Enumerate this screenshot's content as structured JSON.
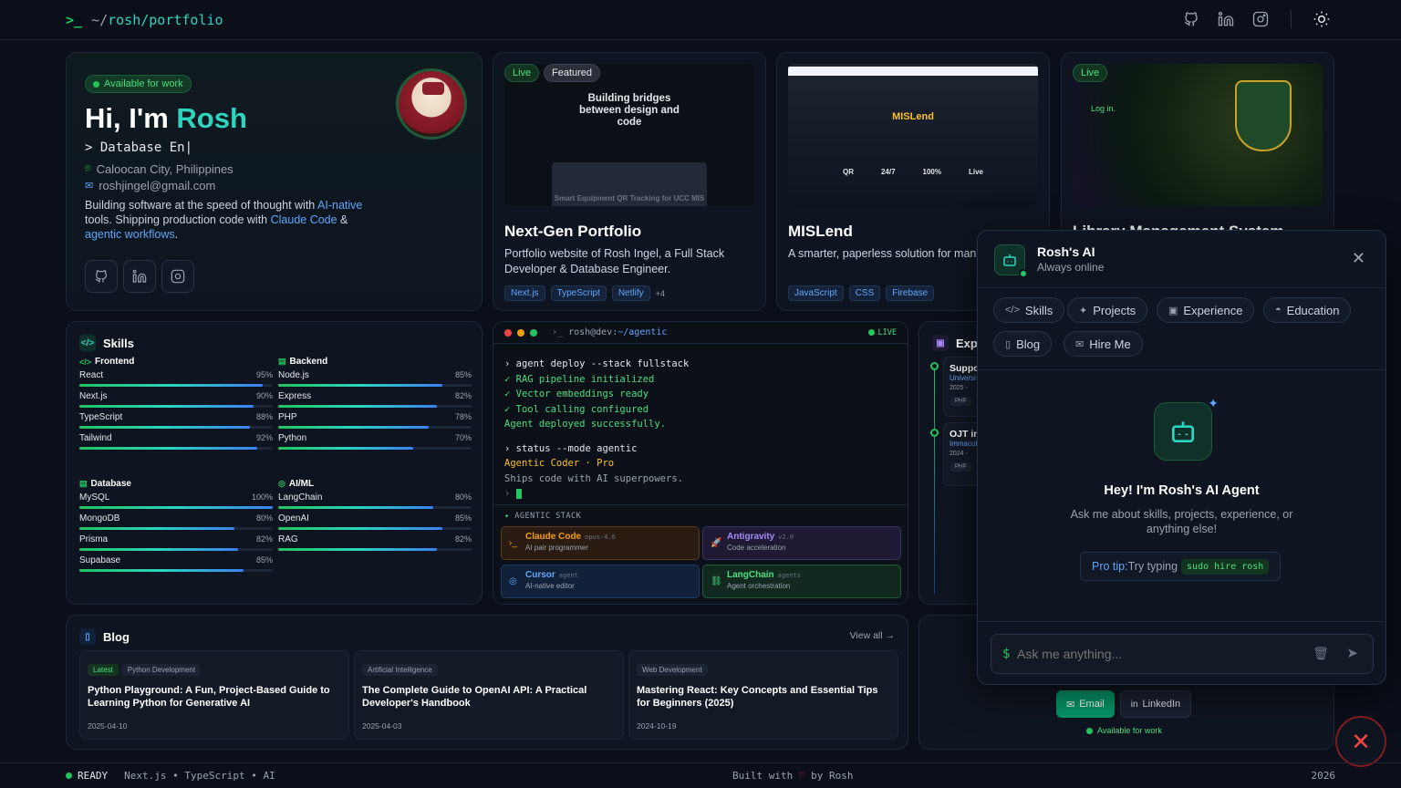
{
  "topbar": {
    "prompt": ">_",
    "path_prefix": "~/",
    "path": "rosh/portfolio"
  },
  "hero": {
    "availability": "Available for work",
    "greeting": "Hi, I'm ",
    "name": "Rosh",
    "typing": "> Database En|",
    "location": "Caloocan City, Philippines",
    "email": "roshjingel@gmail.com",
    "bio_1": "Building software at the speed of thought with ",
    "bio_link_1": "AI-native",
    "bio_2": " tools. Shipping production code with ",
    "bio_link_2": "Claude Code",
    "bio_3": " & ",
    "bio_link_3": "agentic workflows",
    "bio_4": "."
  },
  "projects": [
    {
      "live": "Live",
      "featured": "Featured",
      "screenshot_heading": "Building bridges between design and code",
      "screenshot_sub": "Smart Equipment QR Tracking for UCC MIS",
      "title": "Next-Gen Portfolio",
      "desc": "Portfolio website of Rosh Ingel, a Full Stack Developer & Database Engineer.",
      "tags": [
        "Next.js",
        "TypeScript",
        "Netlify"
      ],
      "more": "+4"
    },
    {
      "screenshot_heading": "MISLend",
      "stats": [
        "QR",
        "24/7",
        "100%",
        "Live"
      ],
      "title": "MISLend",
      "desc": "A smarter, paperless solution for managing classroom tools. Borrow projectors, cabl",
      "tags": [
        "JavaScript",
        "CSS",
        "Firebase"
      ]
    },
    {
      "live": "Live",
      "screenshot_heading": "Log in.",
      "title": "Library Management System"
    }
  ],
  "skills": {
    "title": "Skills",
    "groups": [
      {
        "name": "Frontend",
        "items": [
          {
            "name": "React",
            "pct": "95%",
            "v": 95
          },
          {
            "name": "Next.js",
            "pct": "90%",
            "v": 90
          },
          {
            "name": "TypeScript",
            "pct": "88%",
            "v": 88
          },
          {
            "name": "Tailwind",
            "pct": "92%",
            "v": 92
          }
        ]
      },
      {
        "name": "Backend",
        "items": [
          {
            "name": "Node.js",
            "pct": "85%",
            "v": 85
          },
          {
            "name": "Express",
            "pct": "82%",
            "v": 82
          },
          {
            "name": "PHP",
            "pct": "78%",
            "v": 78
          },
          {
            "name": "Python",
            "pct": "70%",
            "v": 70
          }
        ]
      },
      {
        "name": "Database",
        "items": [
          {
            "name": "MySQL",
            "pct": "100%",
            "v": 100
          },
          {
            "name": "MongoDB",
            "pct": "80%",
            "v": 80
          },
          {
            "name": "Prisma",
            "pct": "82%",
            "v": 82
          },
          {
            "name": "Supabase",
            "pct": "85%",
            "v": 85
          }
        ]
      },
      {
        "name": "AI/ML",
        "items": [
          {
            "name": "LangChain",
            "pct": "80%",
            "v": 80
          },
          {
            "name": "OpenAI",
            "pct": "85%",
            "v": 85
          },
          {
            "name": "RAG",
            "pct": "82%",
            "v": 82
          }
        ]
      }
    ]
  },
  "terminal": {
    "title_prefix": "rosh@dev:",
    "title_path": "~/agentic",
    "live": "LIVE",
    "lines": [
      {
        "text": "› agent deploy --stack fullstack",
        "color": "#e5e7eb"
      },
      {
        "text": "✓ RAG pipeline initialized",
        "color": "#4ade80"
      },
      {
        "text": "✓ Vector embeddings ready",
        "color": "#4ade80"
      },
      {
        "text": "✓ Tool calling configured",
        "color": "#4ade80"
      },
      {
        "text": "Agent deployed successfully.",
        "color": "#4ade80"
      },
      {
        "text": "",
        "color": "#e5e7eb"
      },
      {
        "text": "› status --mode agentic",
        "color": "#e5e7eb"
      },
      {
        "text": "Agentic Coder · Pro",
        "color": "#fbbf24"
      },
      {
        "text": "Ships code with AI superpowers.",
        "color": "#9ca3af"
      },
      {
        "text": "›",
        "color": "#6b7280"
      }
    ],
    "stack_title": "AGENTIC STACK",
    "stack": [
      {
        "name": "Claude Code",
        "ver": "opus-4.6",
        "desc": "AI pair programmer",
        "color": "#f59e0b",
        "bg": "#2a1c12",
        "border": "#5c3a1a",
        "icon": "terminal-icon"
      },
      {
        "name": "Antigravity",
        "ver": "v2.0",
        "desc": "Code acceleration",
        "color": "#a78bfa",
        "bg": "#1e1a33",
        "border": "#3b3366",
        "icon": "rocket-icon"
      },
      {
        "name": "Cursor",
        "ver": "agent",
        "desc": "AI-native editor",
        "color": "#60a5fa",
        "bg": "#12213a",
        "border": "#1f3a66",
        "icon": "cursor-icon"
      },
      {
        "name": "LangChain",
        "ver": "agents",
        "desc": "Agent orchestration",
        "color": "#4ade80",
        "bg": "#12291f",
        "border": "#1f5c3a",
        "icon": "link-icon"
      }
    ]
  },
  "experience": {
    "title": "Expe",
    "items": [
      {
        "role": "Suppo",
        "org": "Universi",
        "date": "2025 -",
        "tags": [
          "PHP",
          "M"
        ]
      },
      {
        "role": "OJT in",
        "org": "Immacul",
        "date": "2024 -",
        "tags": [
          "PHP",
          "M"
        ]
      }
    ]
  },
  "blog": {
    "title": "Blog",
    "view_all": "View all →",
    "posts": [
      {
        "tags": [
          "Latest",
          "Python Development"
        ],
        "title": "Python Playground: A Fun, Project-Based Guide to Learning Python for Generative AI",
        "date": "2025-04-10"
      },
      {
        "tags": [
          "Artificial Intelligence"
        ],
        "title": "The Complete Guide to OpenAI API: A Practical Developer's Handbook",
        "date": "2025-04-03"
      },
      {
        "tags": [
          "Web Development"
        ],
        "title": "Mastering React: Key Concepts and Essential Tips for Beginners (2025)",
        "date": "2024-10-19"
      }
    ]
  },
  "contact": {
    "email": "Email",
    "linkedin": "LinkedIn",
    "status": "Available for work"
  },
  "chat": {
    "name": "Rosh's AI",
    "status": "Always online",
    "chips": [
      {
        "label": "Skills",
        "icon": "</>"
      },
      {
        "label": "Projects",
        "icon": "✦"
      },
      {
        "label": "Experience",
        "icon": "▣"
      },
      {
        "label": "Education",
        "icon": "◓"
      },
      {
        "label": "Blog",
        "icon": "▯"
      },
      {
        "label": "Hire Me",
        "icon": "✉"
      }
    ],
    "heading": "Hey! I'm Rosh's AI Agent",
    "sub": "Ask me about skills, projects, experience, or anything else!",
    "tip_label": "Pro tip:",
    "tip_text": " Try typing ",
    "tip_code": "sudo hire rosh",
    "input_prefix": "$",
    "placeholder": "Ask me anything..."
  },
  "footer": {
    "ready": "READY",
    "stack": "Next.js • TypeScript • AI",
    "built_prefix": "Built with",
    "built_suffix": "by Rosh",
    "year": "2026"
  }
}
